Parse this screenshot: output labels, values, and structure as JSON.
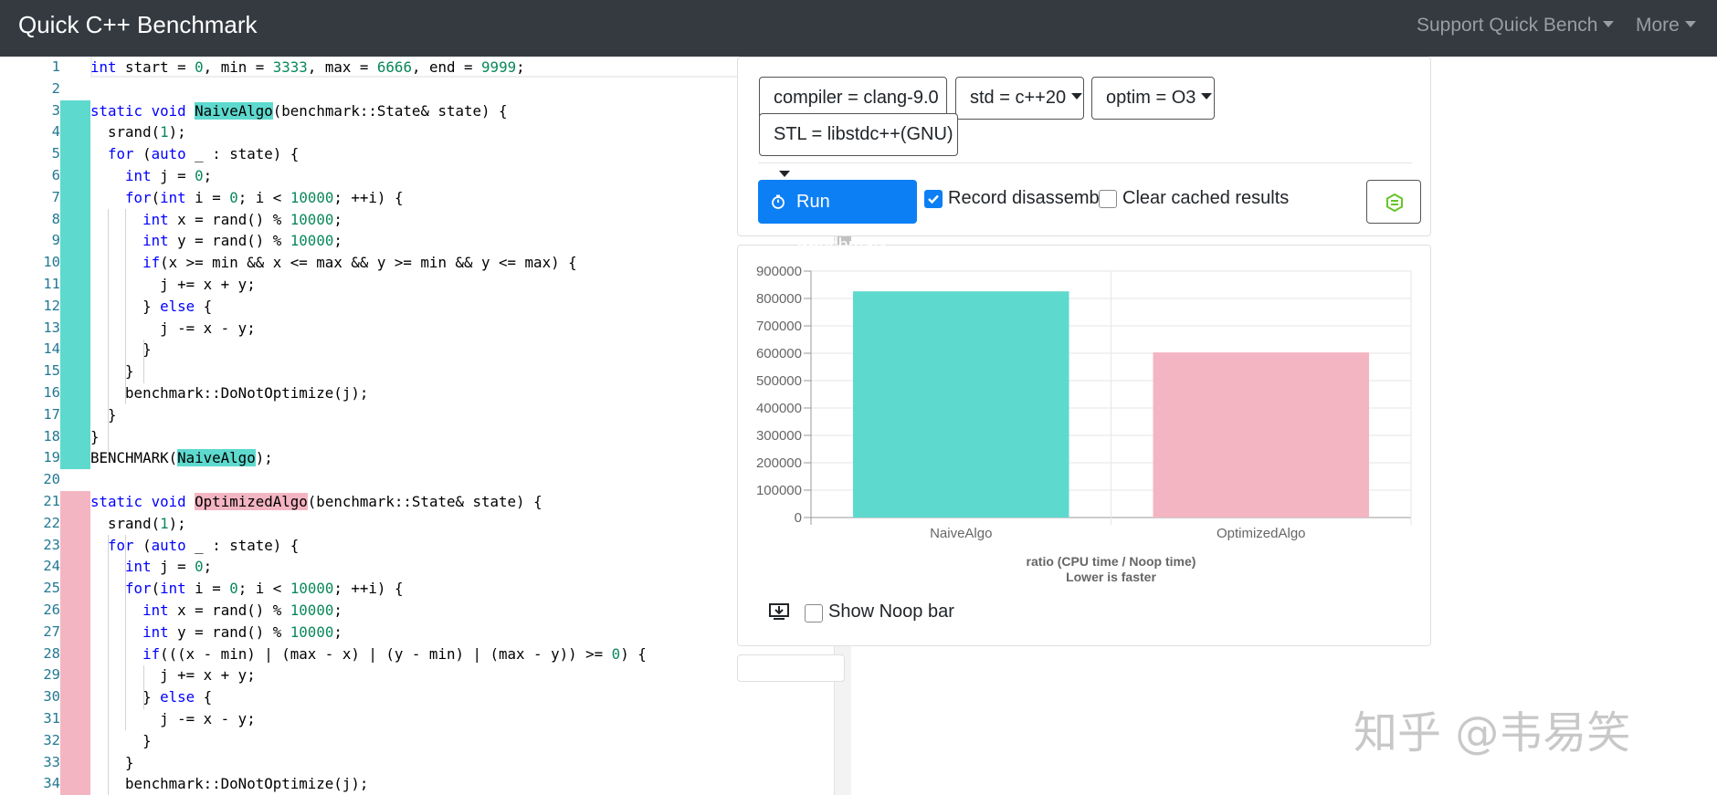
{
  "app": {
    "title": "Quick C++ Benchmark",
    "nav_support": "Support Quick Bench",
    "nav_more": "More"
  },
  "editor": {
    "lines": [
      {
        "n": "1",
        "mark": ""
      },
      {
        "n": "2",
        "mark": ""
      },
      {
        "n": "3",
        "mark": "green"
      },
      {
        "n": "4",
        "mark": "green"
      },
      {
        "n": "5",
        "mark": "green"
      },
      {
        "n": "6",
        "mark": "green"
      },
      {
        "n": "7",
        "mark": "green"
      },
      {
        "n": "8",
        "mark": "green"
      },
      {
        "n": "9",
        "mark": "green"
      },
      {
        "n": "10",
        "mark": "green"
      },
      {
        "n": "11",
        "mark": "green"
      },
      {
        "n": "12",
        "mark": "green"
      },
      {
        "n": "13",
        "mark": "green"
      },
      {
        "n": "14",
        "mark": "green"
      },
      {
        "n": "15",
        "mark": "green"
      },
      {
        "n": "16",
        "mark": "green"
      },
      {
        "n": "17",
        "mark": "green"
      },
      {
        "n": "18",
        "mark": "green"
      },
      {
        "n": "19",
        "mark": "green"
      },
      {
        "n": "20",
        "mark": ""
      },
      {
        "n": "21",
        "mark": "pink"
      },
      {
        "n": "22",
        "mark": "pink"
      },
      {
        "n": "23",
        "mark": "pink"
      },
      {
        "n": "24",
        "mark": "pink"
      },
      {
        "n": "25",
        "mark": "pink"
      },
      {
        "n": "26",
        "mark": "pink"
      },
      {
        "n": "27",
        "mark": "pink"
      },
      {
        "n": "28",
        "mark": "pink"
      },
      {
        "n": "29",
        "mark": "pink"
      },
      {
        "n": "30",
        "mark": "pink"
      },
      {
        "n": "31",
        "mark": "pink"
      },
      {
        "n": "32",
        "mark": "pink"
      },
      {
        "n": "33",
        "mark": "pink"
      },
      {
        "n": "34",
        "mark": "pink"
      }
    ],
    "code": [
      [
        {
          "t": "int",
          "c": "kw"
        },
        {
          "t": " start = "
        },
        {
          "t": "0",
          "c": "num"
        },
        {
          "t": ", min = "
        },
        {
          "t": "3333",
          "c": "num"
        },
        {
          "t": ", max = "
        },
        {
          "t": "6666",
          "c": "num"
        },
        {
          "t": ", end = "
        },
        {
          "t": "9999",
          "c": "num"
        },
        {
          "t": ";"
        }
      ],
      [],
      [
        {
          "t": "static",
          "c": "kw"
        },
        {
          "t": " "
        },
        {
          "t": "void",
          "c": "kw"
        },
        {
          "t": " "
        },
        {
          "t": "NaiveAlgo",
          "c": "hl-green"
        },
        {
          "t": "(benchmark::State& state) {"
        }
      ],
      [
        {
          "t": "  srand("
        },
        {
          "t": "1",
          "c": "num"
        },
        {
          "t": ");"
        }
      ],
      [
        {
          "t": "  "
        },
        {
          "t": "for",
          "c": "kw"
        },
        {
          "t": " ("
        },
        {
          "t": "auto",
          "c": "kw"
        },
        {
          "t": " _ : state) {"
        }
      ],
      [
        {
          "t": "    "
        },
        {
          "t": "int",
          "c": "kw"
        },
        {
          "t": " j = "
        },
        {
          "t": "0",
          "c": "num"
        },
        {
          "t": ";"
        }
      ],
      [
        {
          "t": "    "
        },
        {
          "t": "for",
          "c": "kw"
        },
        {
          "t": "("
        },
        {
          "t": "int",
          "c": "kw"
        },
        {
          "t": " i = "
        },
        {
          "t": "0",
          "c": "num"
        },
        {
          "t": "; i < "
        },
        {
          "t": "10000",
          "c": "num"
        },
        {
          "t": "; ++i) {"
        }
      ],
      [
        {
          "t": "      "
        },
        {
          "t": "int",
          "c": "kw"
        },
        {
          "t": " x = rand() % "
        },
        {
          "t": "10000",
          "c": "num"
        },
        {
          "t": ";"
        }
      ],
      [
        {
          "t": "      "
        },
        {
          "t": "int",
          "c": "kw"
        },
        {
          "t": " y = rand() % "
        },
        {
          "t": "10000",
          "c": "num"
        },
        {
          "t": ";"
        }
      ],
      [
        {
          "t": "      "
        },
        {
          "t": "if",
          "c": "kw"
        },
        {
          "t": "(x >= min && x <= max && y >= min && y <= max) {"
        }
      ],
      [
        {
          "t": "        j += x + y;"
        }
      ],
      [
        {
          "t": "      } "
        },
        {
          "t": "else",
          "c": "kw"
        },
        {
          "t": " {"
        }
      ],
      [
        {
          "t": "        j -= x - y;"
        }
      ],
      [
        {
          "t": "      }"
        }
      ],
      [
        {
          "t": "    }"
        }
      ],
      [
        {
          "t": "    benchmark::DoNotOptimize(j);"
        }
      ],
      [
        {
          "t": "  }"
        }
      ],
      [
        {
          "t": "}"
        }
      ],
      [
        {
          "t": "BENCHMARK("
        },
        {
          "t": "NaiveAlgo",
          "c": "hl-green"
        },
        {
          "t": ");"
        }
      ],
      [],
      [
        {
          "t": "static",
          "c": "kw"
        },
        {
          "t": " "
        },
        {
          "t": "void",
          "c": "kw"
        },
        {
          "t": " "
        },
        {
          "t": "OptimizedAlgo",
          "c": "hl-pink"
        },
        {
          "t": "(benchmark::State& state) {"
        }
      ],
      [
        {
          "t": "  srand("
        },
        {
          "t": "1",
          "c": "num"
        },
        {
          "t": ");"
        }
      ],
      [
        {
          "t": "  "
        },
        {
          "t": "for",
          "c": "kw"
        },
        {
          "t": " ("
        },
        {
          "t": "auto",
          "c": "kw"
        },
        {
          "t": " _ : state) {"
        }
      ],
      [
        {
          "t": "    "
        },
        {
          "t": "int",
          "c": "kw"
        },
        {
          "t": " j = "
        },
        {
          "t": "0",
          "c": "num"
        },
        {
          "t": ";"
        }
      ],
      [
        {
          "t": "    "
        },
        {
          "t": "for",
          "c": "kw"
        },
        {
          "t": "("
        },
        {
          "t": "int",
          "c": "kw"
        },
        {
          "t": " i = "
        },
        {
          "t": "0",
          "c": "num"
        },
        {
          "t": "; i < "
        },
        {
          "t": "10000",
          "c": "num"
        },
        {
          "t": "; ++i) {"
        }
      ],
      [
        {
          "t": "      "
        },
        {
          "t": "int",
          "c": "kw"
        },
        {
          "t": " x = rand() % "
        },
        {
          "t": "10000",
          "c": "num"
        },
        {
          "t": ";"
        }
      ],
      [
        {
          "t": "      "
        },
        {
          "t": "int",
          "c": "kw"
        },
        {
          "t": " y = rand() % "
        },
        {
          "t": "10000",
          "c": "num"
        },
        {
          "t": ";"
        }
      ],
      [
        {
          "t": "      "
        },
        {
          "t": "if",
          "c": "kw"
        },
        {
          "t": "(((x - min) | (max - x) | (y - min) | (max - y)) >= "
        },
        {
          "t": "0",
          "c": "num"
        },
        {
          "t": ") {"
        }
      ],
      [
        {
          "t": "        j += x + y;"
        }
      ],
      [
        {
          "t": "      } "
        },
        {
          "t": "else",
          "c": "kw"
        },
        {
          "t": " {"
        }
      ],
      [
        {
          "t": "        j -= x - y;"
        }
      ],
      [
        {
          "t": "      }"
        }
      ],
      [
        {
          "t": "    }"
        }
      ],
      [
        {
          "t": "    benchmark::DoNotOptimize(j);"
        }
      ]
    ]
  },
  "options": {
    "compiler": "compiler = clang-9.0",
    "std": "std = c++20",
    "optim": "optim = O3",
    "stl": "STL = libstdc++(GNU)"
  },
  "actions": {
    "run_label": "Run Benchmark",
    "record_label": "Record disassembly",
    "record_checked": true,
    "clear_label": "Clear cached results",
    "clear_checked": false,
    "show_noop_label": "Show Noop bar",
    "show_noop_checked": false
  },
  "chart_data": {
    "type": "bar",
    "categories": [
      "NaiveAlgo",
      "OptimizedAlgo"
    ],
    "values": [
      826000,
      603000
    ],
    "colors": [
      "#5ed9ce",
      "#f4b5c2"
    ],
    "ylim": [
      0,
      900000
    ],
    "yticks": [
      "0",
      "100000",
      "200000",
      "300000",
      "400000",
      "500000",
      "600000",
      "700000",
      "800000",
      "900000"
    ],
    "xlabel_line1": "ratio (CPU time / Noop time)",
    "xlabel_line2": "Lower is faster",
    "grid": true
  },
  "watermark": "知乎 @韦易笑",
  "colors": {
    "navbar": "#343a40",
    "primary": "#0d7ff5",
    "naive": "#5ed9ce",
    "optimized": "#f4b5c2"
  }
}
